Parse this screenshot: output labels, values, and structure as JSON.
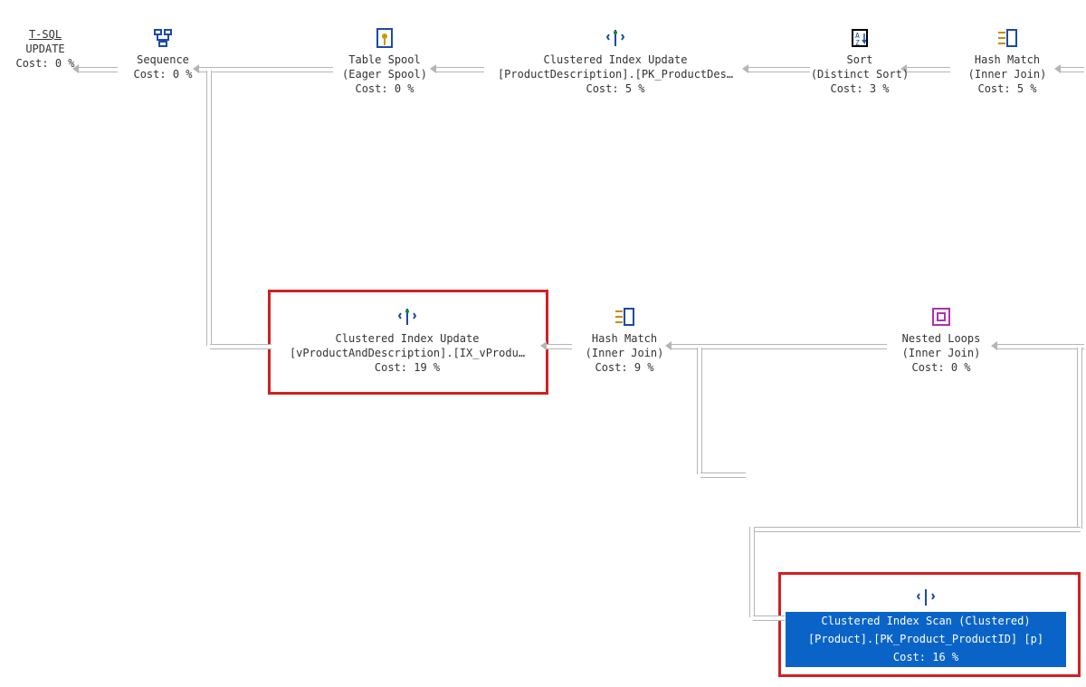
{
  "chart_data": {
    "type": "table",
    "title": "SQL Execution Plan",
    "nodes": [
      {
        "id": "tsql",
        "label": "T-SQL",
        "op": "UPDATE",
        "cost": 0
      },
      {
        "id": "seq",
        "label": "Sequence",
        "cost": 0
      },
      {
        "id": "spool",
        "label": "Table Spool",
        "sub": "(Eager Spool)",
        "cost": 0
      },
      {
        "id": "ciu1",
        "label": "Clustered Index Update",
        "obj": "[ProductDescription].[PK_ProductDes…",
        "cost": 5
      },
      {
        "id": "sort",
        "label": "Sort",
        "sub": "(Distinct Sort)",
        "cost": 3
      },
      {
        "id": "hm1",
        "label": "Hash Match",
        "sub": "(Inner Join)",
        "cost": 5
      },
      {
        "id": "ciu2",
        "label": "Clustered Index Update",
        "obj": "[vProductAndDescription].[IX_vProdu…",
        "cost": 19,
        "highlighted": true
      },
      {
        "id": "hm2",
        "label": "Hash Match",
        "sub": "(Inner Join)",
        "cost": 9
      },
      {
        "id": "nl",
        "label": "Nested Loops",
        "sub": "(Inner Join)",
        "cost": 0
      },
      {
        "id": "cis",
        "label": "Clustered Index Scan (Clustered)",
        "obj": "[Product].[PK_Product_ProductID] [p]",
        "cost": 16,
        "highlighted": true,
        "selected": true
      }
    ],
    "edges": [
      [
        "seq",
        "tsql"
      ],
      [
        "spool",
        "seq"
      ],
      [
        "ciu1",
        "spool"
      ],
      [
        "sort",
        "ciu1"
      ],
      [
        "hm1",
        "sort"
      ],
      [
        "ciu2",
        "seq"
      ],
      [
        "hm2",
        "ciu2"
      ],
      [
        "nl",
        "hm2"
      ],
      [
        "cis",
        "nl"
      ]
    ]
  },
  "n": {
    "tsql": {
      "l1": "T-SQL",
      "l2": "UPDATE",
      "l3": "Cost: 0 %"
    },
    "seq": {
      "l1": "Sequence",
      "l2": "Cost: 0 %"
    },
    "spool": {
      "l1": "Table Spool",
      "l2": "(Eager Spool)",
      "l3": "Cost: 0 %"
    },
    "ciu1": {
      "l1": "Clustered Index Update",
      "l2": "[ProductDescription].[PK_ProductDes…",
      "l3": "Cost: 5 %"
    },
    "sort": {
      "l1": "Sort",
      "l2": "(Distinct Sort)",
      "l3": "Cost: 3 %"
    },
    "hm1": {
      "l1": "Hash Match",
      "l2": "(Inner Join)",
      "l3": "Cost: 5 %"
    },
    "ciu2": {
      "l1": "Clustered Index Update",
      "l2": "[vProductAndDescription].[IX_vProdu…",
      "l3": "Cost: 19 %"
    },
    "hm2": {
      "l1": "Hash Match",
      "l2": "(Inner Join)",
      "l3": "Cost: 9 %"
    },
    "nl": {
      "l1": "Nested Loops",
      "l2": "(Inner Join)",
      "l3": "Cost: 0 %"
    },
    "cis": {
      "l1": "Clustered Index Scan (Clustered)",
      "l2": "[Product].[PK_Product_ProductID] [p]",
      "l3": "Cost: 16 %"
    }
  }
}
